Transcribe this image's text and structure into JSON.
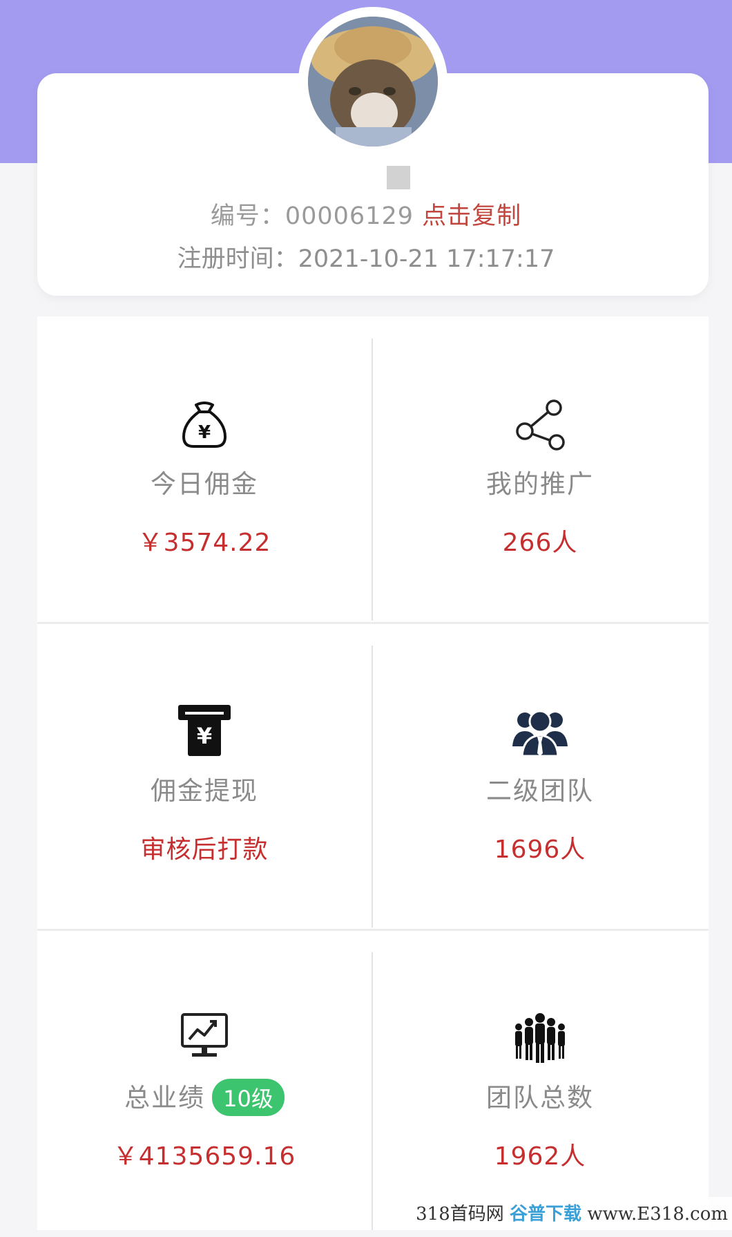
{
  "profile": {
    "id_label": "编号：",
    "id_value": "00006129",
    "copy_label": "点击复制",
    "reg_label": "注册时间：",
    "reg_time": "2021-10-21 17:17:17"
  },
  "stats": [
    {
      "label": "今日佣金",
      "value": "￥3574.22",
      "icon": "money-bag-icon"
    },
    {
      "label": "我的推广",
      "value": "266人",
      "icon": "share-icon"
    },
    {
      "label": "佣金提现",
      "value": "审核后打款",
      "icon": "withdraw-icon"
    },
    {
      "label": "二级团队",
      "value": "1696人",
      "icon": "team-icon"
    },
    {
      "label": "总业绩",
      "badge": "10级",
      "value": "￥4135659.16",
      "icon": "performance-chart-icon"
    },
    {
      "label": "团队总数",
      "value": "1962人",
      "icon": "people-group-icon"
    }
  ],
  "watermark": {
    "text": "318首码网",
    "brand": "谷普下载",
    "url": "www.E318.com"
  },
  "colors": {
    "header_purple": "#a29bf0",
    "value_red": "#c62f2f",
    "copy_red": "#c2463e",
    "badge_green": "#3dc46e"
  }
}
